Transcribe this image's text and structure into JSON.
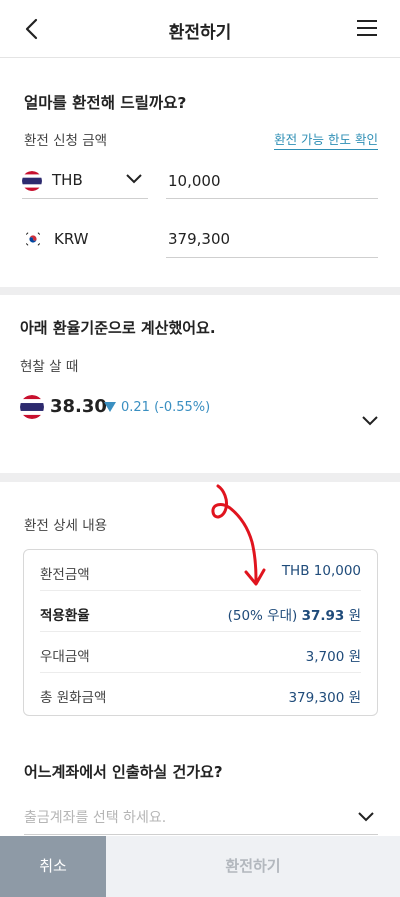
{
  "header": {
    "title": "환전하기"
  },
  "amount_section": {
    "question": "얼마를 환전해 드릴까요?",
    "request_label": "환전 신청 금액",
    "limit_link": "환전 가능 한도 확인",
    "from_currency": "THB",
    "from_amount": "10,000",
    "to_currency": "KRW",
    "to_amount": "379,300"
  },
  "rate_section": {
    "title": "아래 환율기준으로 계산했어요.",
    "subtitle": "현찰 살 때",
    "rate": "38.30",
    "change": "0.21 (-0.55%)",
    "change_color": "#3a8fc1"
  },
  "detail_section": {
    "title": "환전 상세 내용",
    "rows": [
      {
        "label": "환전금액",
        "value": "THB 10,000"
      },
      {
        "label": "적용환율",
        "value_prefix": "(50% 우대)",
        "value_strong": "37.93",
        "value_unit": "원"
      },
      {
        "label": "우대금액",
        "value": "3,700 원"
      },
      {
        "label": "총 원화금액",
        "value": "379,300 원"
      }
    ]
  },
  "withdraw_section": {
    "question": "어느계좌에서 인출하실 건가요?",
    "placeholder": "출금계좌를 선택 하세요."
  },
  "footer": {
    "cancel_label": "취소",
    "exchange_label": "환전하기"
  },
  "colors": {
    "accent": "#2f8fb5",
    "value_text": "#1f4b7a",
    "cancel_bg": "#8e9aa6",
    "disabled_bg": "#eff1f4",
    "annotation": "#e0141e"
  }
}
